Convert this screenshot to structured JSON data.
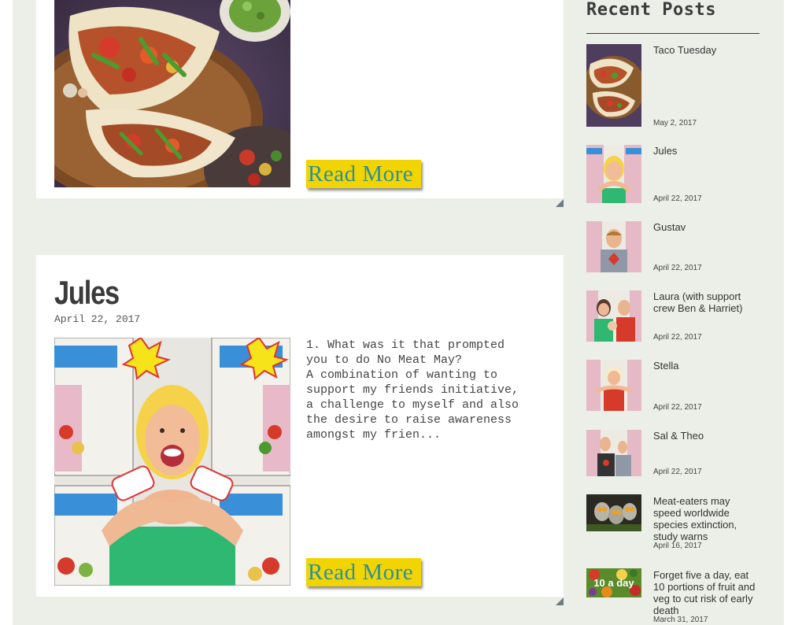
{
  "posts": [
    {
      "read_more": "Read More",
      "image_icon": "taco-plate-photo"
    },
    {
      "title": "Jules",
      "date": "April 22, 2017",
      "excerpt": "1. What was it that prompted\nyou to do No Meat May?\nA combination of wanting to\nsupport my friends initiative,\na challenge to myself and also\nthe desire to raise awareness\namongst my frien...",
      "read_more": "Read More",
      "image_icon": "woman-crossed-arms-photo"
    }
  ],
  "sidebar": {
    "title": "Recent Posts",
    "items": [
      {
        "title": "Taco Tuesday",
        "date": "May 2, 2017"
      },
      {
        "title": "Jules",
        "date": "April 22, 2017"
      },
      {
        "title": "Gustav",
        "date": "April 22, 2017"
      },
      {
        "title": "Laura (with support crew Ben & Harriet)",
        "date": "April 22, 2017"
      },
      {
        "title": "Stella",
        "date": "April 22, 2017"
      },
      {
        "title": "Sal & Theo",
        "date": "April 22, 2017"
      },
      {
        "title": "Meat-eaters may speed worldwide species extinction, study warns",
        "date": "April 16, 2017"
      },
      {
        "title": "Forget five a day, eat 10 portions of fruit and veg to cut risk of early death",
        "date": "March 31, 2017",
        "thumb_text": "10 a day"
      }
    ]
  },
  "colors": {
    "page_bg": "#ecefe7",
    "button_bg": "#f2d500",
    "button_text": "#2f8f9c"
  }
}
